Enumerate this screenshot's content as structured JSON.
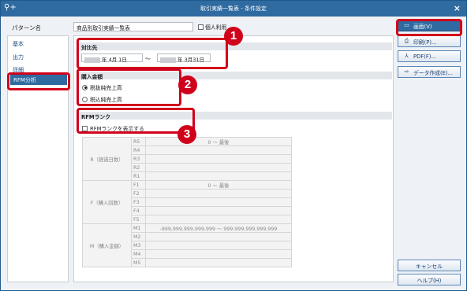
{
  "window": {
    "title": "取引実績一覧表 - 条件設定",
    "close": "×",
    "app_icon": "search-plus-icon"
  },
  "pattern": {
    "label": "パターン名",
    "value": "商品別取引実績一覧表",
    "checkbox_label": "個人利用"
  },
  "nav": {
    "items": [
      "基本",
      "出力",
      "詳細"
    ],
    "active": "RFM分析"
  },
  "section1": {
    "title": "対比先",
    "from_text": "年  4月  1日",
    "tilde": "～",
    "to_text": "年  3月31日"
  },
  "section2": {
    "title": "購入金額",
    "options": [
      "税抜純売上高",
      "税込純売上高"
    ],
    "selected_index": 0
  },
  "section3": {
    "title": "RFMランク",
    "checkbox_label": "RFMランクを表示する",
    "checked": false
  },
  "rfm_table": {
    "groups": [
      {
        "label": "R（経過日数）",
        "rows": [
          {
            "code": "R5",
            "value": "0  ～  最後"
          },
          {
            "code": "R4",
            "value": ""
          },
          {
            "code": "R3",
            "value": ""
          },
          {
            "code": "R2",
            "value": ""
          },
          {
            "code": "R1",
            "value": ""
          }
        ]
      },
      {
        "label": "F（購入回数）",
        "rows": [
          {
            "code": "F1",
            "value": "0  ～  最後"
          },
          {
            "code": "F2",
            "value": ""
          },
          {
            "code": "F3",
            "value": ""
          },
          {
            "code": "F4",
            "value": ""
          },
          {
            "code": "F5",
            "value": ""
          }
        ]
      },
      {
        "label": "M（購入金額）",
        "rows": [
          {
            "code": "M1",
            "value": "-999,999,999,999,999  ～  999,999,999,999,999"
          },
          {
            "code": "M2",
            "value": ""
          },
          {
            "code": "M3",
            "value": ""
          },
          {
            "code": "M4",
            "value": ""
          },
          {
            "code": "M5",
            "value": ""
          }
        ]
      }
    ]
  },
  "buttons": {
    "screen": "画面(V)",
    "print": "印刷(P)...",
    "pdf": "PDF(F)...",
    "data": "データ作成(E)...",
    "cancel": "キャンセル",
    "help": "ヘルプ(H)"
  },
  "callouts": [
    "1",
    "2",
    "3"
  ],
  "colors": {
    "titlebar": "#2f6aa0",
    "highlight": "#d0021b"
  }
}
